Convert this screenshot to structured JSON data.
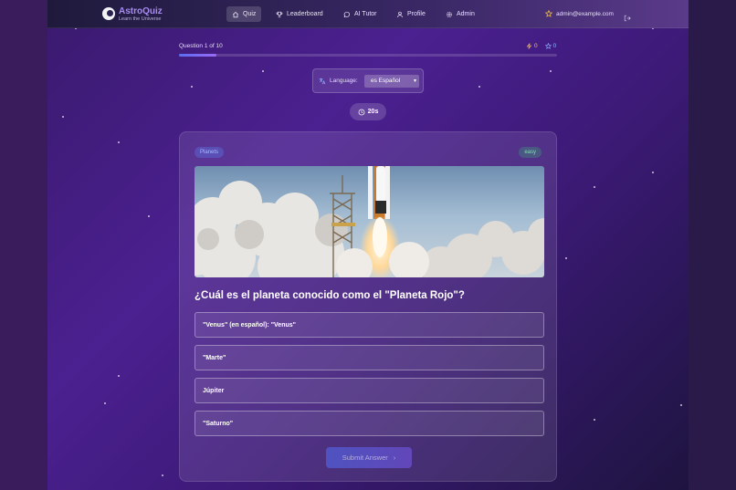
{
  "app": {
    "name": "AstroQuiz",
    "tagline": "Learn the Universe"
  },
  "nav": {
    "items": [
      {
        "label": "Quiz",
        "icon": "home-icon",
        "active": true
      },
      {
        "label": "Leaderboard",
        "icon": "trophy-icon",
        "active": false
      },
      {
        "label": "AI Tutor",
        "icon": "chat-icon",
        "active": false
      },
      {
        "label": "Profile",
        "icon": "user-icon",
        "active": false
      },
      {
        "label": "Admin",
        "icon": "gear-icon",
        "active": false
      }
    ],
    "user_email": "admin@example.com"
  },
  "progress": {
    "label": "Question 1 of 10",
    "fraction": 0.1,
    "streak": "0",
    "points": "0"
  },
  "language": {
    "label": "Language:",
    "selected": "es Español"
  },
  "timer": {
    "value": "20s"
  },
  "question": {
    "category": "Planets",
    "difficulty": "easy",
    "text": "¿Cuál es el planeta conocido como el \"Planeta Rojo\"?",
    "options": [
      "\"Venus\" (en español): \"Venus\"",
      "\"Marte\"",
      "Júpiter",
      "\"Saturno\""
    ],
    "submit_label": "Submit Answer"
  },
  "colors": {
    "accent": "#a98cf0",
    "streak": "#f5c542",
    "points": "#8fb3ff",
    "category_badge": "#a9bcff",
    "difficulty_badge": "#7fe0b4"
  }
}
